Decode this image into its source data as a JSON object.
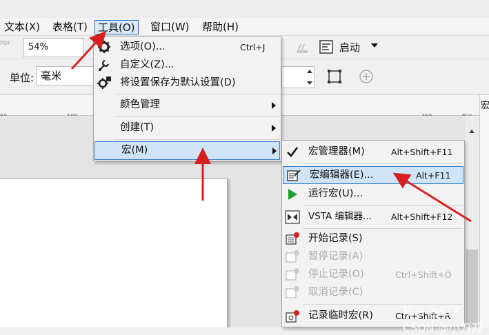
{
  "menubar": {
    "items": [
      {
        "label": "文本(X)"
      },
      {
        "label": "表格(T)"
      },
      {
        "label": "工具(O)"
      },
      {
        "label": "窗口(W)"
      },
      {
        "label": "帮助(H)"
      }
    ]
  },
  "toolbar": {
    "zoom_value": "54%",
    "launch_label": "启动",
    "unit_label": "单位:",
    "unit_value": "毫米",
    "pdf_label": "PDF"
  },
  "ruler": {
    "ticks": [
      "50",
      "100",
      "350"
    ],
    "unit": "毫米",
    "small_ticks": [
      "150"
    ]
  },
  "docker": {
    "label": "宏"
  },
  "tools_menu": {
    "items": [
      {
        "label": "选项(O)...",
        "shortcut": "Ctrl+J"
      },
      {
        "label": "自定义(Z)..."
      },
      {
        "label": "将设置保存为默认设置(D)"
      },
      {
        "label": "颜色管理"
      },
      {
        "label": "创建(T)"
      },
      {
        "label": "宏(M)"
      }
    ]
  },
  "macro_menu": {
    "items": [
      {
        "label": "宏管理器(M)",
        "shortcut": "Alt+Shift+F11"
      },
      {
        "label": "宏编辑器(E)...",
        "shortcut": "Alt+F11"
      },
      {
        "label": "运行宏(U)..."
      },
      {
        "label": "VSTA 编辑器...",
        "shortcut": "Alt+Shift+F12"
      },
      {
        "label": "开始记录(S)"
      },
      {
        "label": "暂停记录(A)"
      },
      {
        "label": "停止记录(O)",
        "shortcut": "Ctrl+Shift+O"
      },
      {
        "label": "取消记录(C)"
      },
      {
        "label": "记录临时宏(R)",
        "shortcut": "Ctrl+Shift+R"
      }
    ]
  },
  "watermark": {
    "text": "知乎 @知了 CSDN @小刀刀"
  },
  "colors": {
    "accent": "#1e6fd0",
    "annotation": "#d62020",
    "play": "#1aa12e"
  }
}
